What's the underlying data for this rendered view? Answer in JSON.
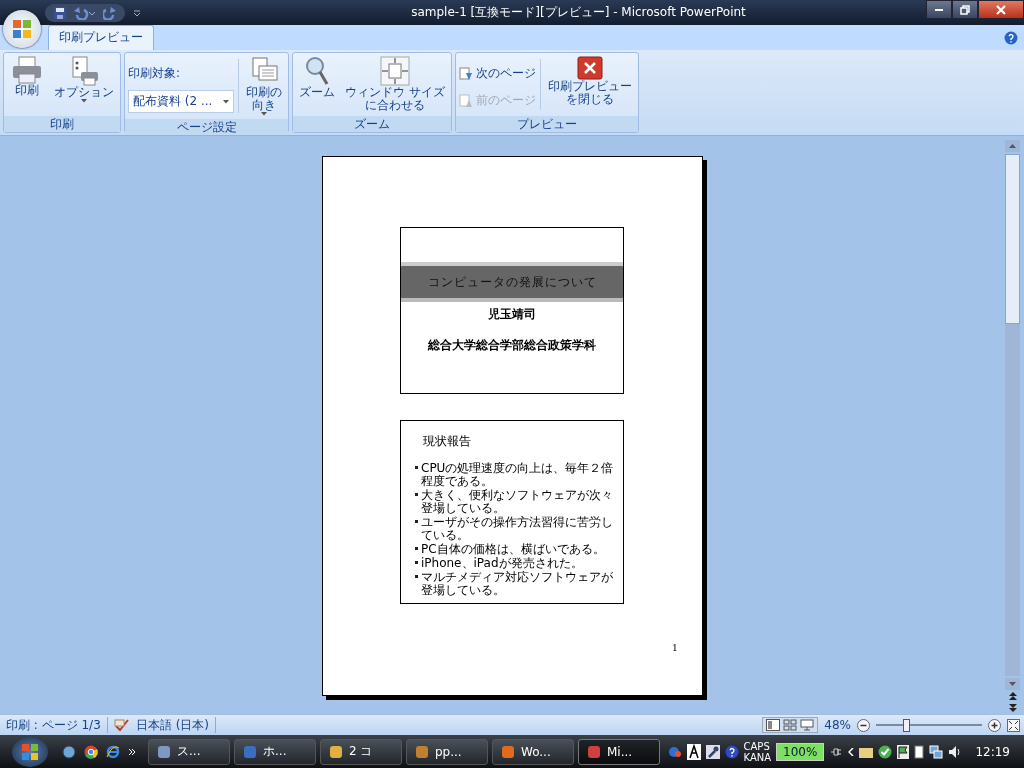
{
  "window": {
    "title": "sample-1 [互換モード][プレビュー] - Microsoft PowerPoint"
  },
  "tabs": [
    {
      "label": "印刷プレビュー",
      "selected": true
    }
  ],
  "ribbon_groups": [
    {
      "label": "印刷",
      "items": [
        {
          "kind": "large",
          "lines": [
            "印刷"
          ],
          "dropdown": false
        },
        {
          "kind": "large",
          "lines": [
            "オプション"
          ],
          "dropdown": true
        }
      ]
    },
    {
      "label": "ページ設定",
      "items": [
        {
          "kind": "field",
          "label": "印刷対象:",
          "value": "配布資料 (2 ..."
        },
        {
          "kind": "large",
          "lines": [
            "印刷の",
            "向き"
          ],
          "dropdown": true
        }
      ]
    },
    {
      "label": "ズーム",
      "items": [
        {
          "kind": "large",
          "lines": [
            "ズーム"
          ],
          "dropdown": false
        },
        {
          "kind": "large",
          "lines": [
            "ウィンドウ サイズ",
            "に合わせる"
          ],
          "dropdown": false
        }
      ]
    },
    {
      "label": "プレビュー",
      "items": [
        {
          "kind": "small-stack",
          "buttons": [
            {
              "label": "次のページ",
              "disabled": false
            },
            {
              "label": "前のページ",
              "disabled": true
            }
          ]
        },
        {
          "kind": "large",
          "lines": [
            "印刷プレビュー",
            "を閉じる"
          ],
          "dropdown": false
        }
      ]
    }
  ],
  "slides": [
    {
      "kind": "title",
      "title": "コンピュータの発展について",
      "author": "児玉靖司",
      "affiliation": "総合大学総合学部総合政策学科"
    },
    {
      "kind": "bullets",
      "title": "現状報告",
      "bullets": [
        "CPUの処理速度の向上は、毎年２倍程度である。",
        "大きく、便利なソフトウェアが次々登場している。",
        "ユーザがその操作方法習得に苦労している。",
        "PC自体の価格は、横ばいである。",
        "iPhone、iPadが発売された。",
        "マルチメディア対応ソフトウェアが登場している。"
      ]
    }
  ],
  "page_number": "1",
  "status_bar": {
    "page": "印刷 : ページ 1/3",
    "language": "日本語 (日本)",
    "zoom": "48%",
    "zoom_level": {
      "level": 0.28
    }
  },
  "taskbar": {
    "buttons": [
      {
        "label": "ス...",
        "selected": false
      },
      {
        "label": "ホ...",
        "selected": false
      },
      {
        "label": "2 コ",
        "selected": false
      },
      {
        "label": "pp...",
        "selected": false
      },
      {
        "label": "Wo...",
        "selected": false
      },
      {
        "label": "Mi...",
        "selected": true
      }
    ],
    "caps": "CAPS",
    "kana": "KANA",
    "battery": "100%",
    "clock": "12:19"
  }
}
